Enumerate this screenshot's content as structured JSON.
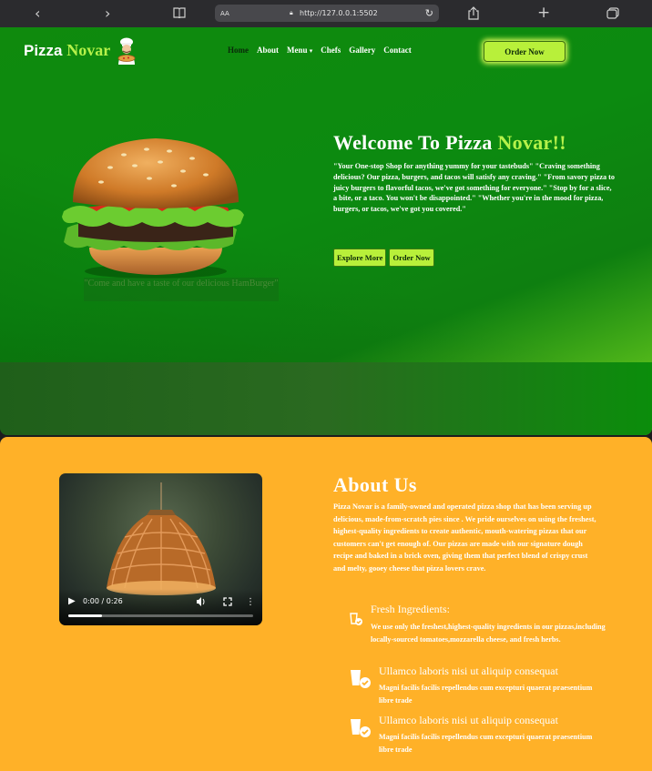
{
  "browser": {
    "back_icon": "chevron-left",
    "forward_icon": "chevron-right",
    "reader_icon": "book",
    "text_size": "AA",
    "url": "http://127.0.0.1:5502",
    "share_icon": "share",
    "new_tab_icon": "plus",
    "tabs_icon": "tabs"
  },
  "header": {
    "logo_word1": "Pizza",
    "logo_word2": "Novar",
    "nav": [
      "Home",
      "About",
      "Menu",
      "Chefs",
      "Gallery",
      "Contact"
    ],
    "menu_caret": "▾",
    "order_button": "Order Now"
  },
  "hero": {
    "title_word1": "Welcome To Pizza",
    "title_word2": "Novar!!",
    "paragraph": "\"Your One-stop Shop for anything yummy for your tastebuds\" \"Craving something delicious? Our pizza, burgers, and tacos will satisfy any craving.\" \"From savory pizza to juicy burgers to flavorful tacos, we've got something for everyone.\" \"Stop by for a slice, a bite, or a taco. You won't be disappointed.\" \"Whether you're in the mood for pizza, burgers, or tacos, we've got you covered.\"",
    "caption": "\"Come and have a taste of our delicious HamBurger\"",
    "explore_button": "Explore More",
    "order_button": "Order Now"
  },
  "about": {
    "title": "About Us",
    "paragraph": "Pizza Novar is a family-owned and operated pizza shop that has been serving up delicious, made-from-scratch pies since . We pride ourselves on using the freshest, highest-quality ingredients to create authentic, mouth-watering pizzas that our customers can't get enough of. Our pizzas are made with our signature dough recipe and baked in a brick oven, giving them that perfect blend of crispy crust and melty, gooey cheese that pizza lovers crave.",
    "video": {
      "current_time": "0:00",
      "duration": "0:26",
      "progress": 0.0
    },
    "features": [
      {
        "title": "Fresh Ingredients:",
        "desc": "We use only the freshest,highest-quality ingredients in our pizzas,including locally-sourced tomatoes,mozzarella cheese, and fresh herbs."
      },
      {
        "title": "Ullamco laboris nisi ut aliquip consequat",
        "desc": "Magni facilis facilis repellendus cum excepturi quaerat praesentium libre trade"
      },
      {
        "title": "Ullamco laboris nisi ut aliquip consequat",
        "desc": "Magni facilis facilis repellendus cum excepturi quaerat praesentium libre trade"
      }
    ]
  },
  "colors": {
    "accent": "#b5f24a",
    "hero_green": "#0c8a10",
    "about_bg": "#ffb128"
  }
}
